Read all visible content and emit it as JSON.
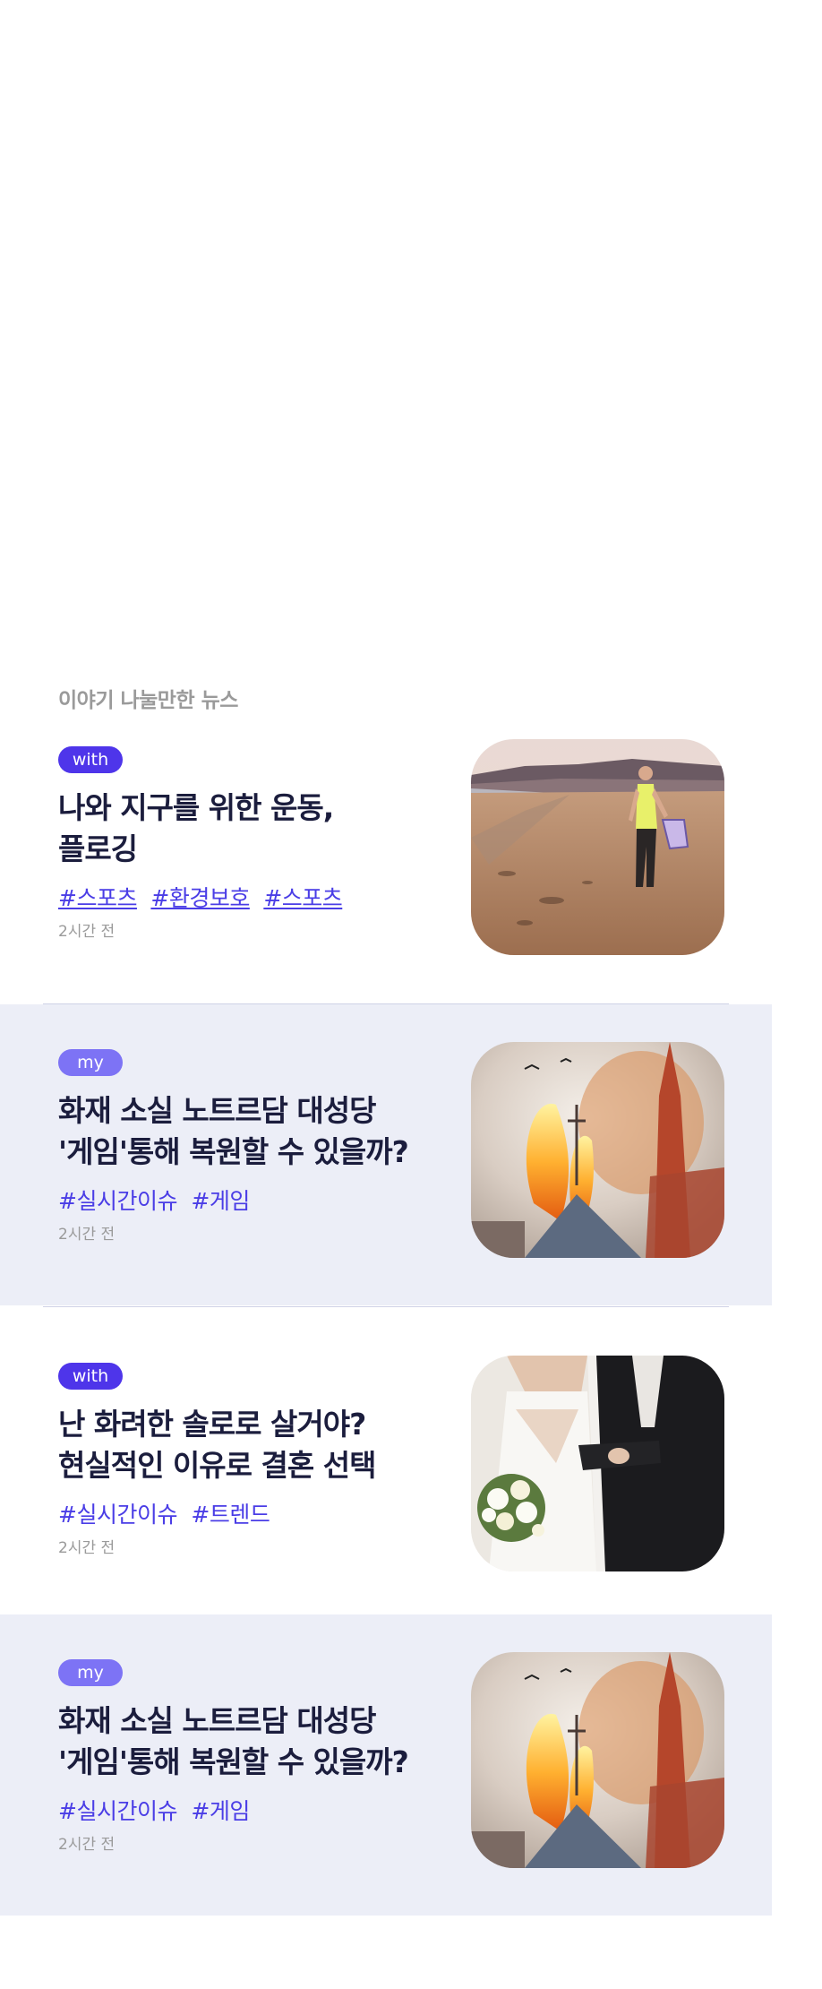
{
  "section": {
    "title": "이야기 나눌만한 뉴스"
  },
  "cards": [
    {
      "badge": "with",
      "headline": "나와 지구를 위한 운동,\n플로깅",
      "tags": [
        "#스포츠",
        "#환경보호",
        "#스포츠"
      ],
      "time": "2시간 전",
      "image": "beach-runner-photo"
    },
    {
      "badge": "my",
      "headline": "화재 소실 노트르담 대성당\n'게임'통해 복원할 수 있을까?",
      "tags": [
        "#실시간이슈",
        "#게임"
      ],
      "time": "2시간 전",
      "image": "notre-dame-fire-photo"
    },
    {
      "badge": "with",
      "headline": "난 화려한 솔로로 살거야?\n현실적인 이유로 결혼 선택",
      "tags": [
        "#실시간이슈",
        "#트렌드"
      ],
      "time": "2시간 전",
      "image": "wedding-couple-photo"
    },
    {
      "badge": "my",
      "headline": "화재 소실 노트르담 대성당\n'게임'통해 복원할 수 있을까?",
      "tags": [
        "#실시간이슈",
        "#게임"
      ],
      "time": "2시간 전",
      "image": "notre-dame-fire-photo"
    }
  ],
  "colors": {
    "accent": "#4e35ea",
    "badge_my": "#7d73f5",
    "shaded_background": "#eceef7",
    "headline": "#1b1d3d",
    "muted": "#9a9a9a"
  }
}
